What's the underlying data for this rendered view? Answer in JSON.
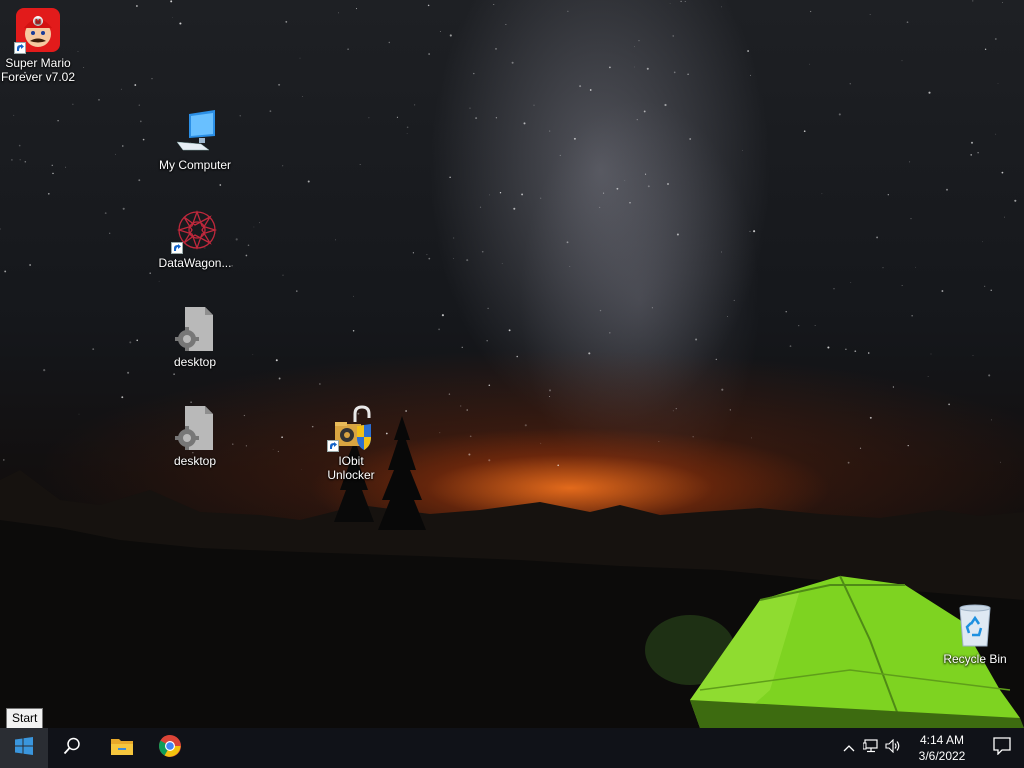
{
  "desktop": {
    "icons": [
      {
        "label": "Super Mario\nForever v7.02",
        "icon": "mario-icon",
        "shortcut": true
      },
      {
        "label": "My Computer",
        "icon": "computer-icon",
        "shortcut": false
      },
      {
        "label": "DataWagon...",
        "icon": "datawagon-icon",
        "shortcut": true
      },
      {
        "label": "desktop",
        "icon": "settings-file-icon",
        "shortcut": false
      },
      {
        "label": "desktop",
        "icon": "settings-file-icon",
        "shortcut": false
      },
      {
        "label": "IObit\nUnlocker",
        "icon": "iobit-unlocker-icon",
        "shortcut": true
      },
      {
        "label": "Recycle Bin",
        "icon": "recycle-bin-icon",
        "shortcut": false
      }
    ]
  },
  "tooltip": {
    "text": "Start"
  },
  "taskbar": {
    "start_icon": "windows-logo-icon",
    "search_icon": "search-icon",
    "pinned": [
      {
        "name": "File Explorer",
        "icon": "folder-icon"
      },
      {
        "name": "Google Chrome",
        "icon": "chrome-icon"
      }
    ],
    "tray_icons": [
      "chevron-up-icon",
      "network-icon",
      "volume-icon"
    ],
    "clock": {
      "time": "4:14 AM",
      "date": "3/6/2022"
    },
    "notification_icon": "notification-icon"
  },
  "colors": {
    "taskbar": "#101218",
    "accent": "#0078d7",
    "tent": "#7ed321"
  }
}
